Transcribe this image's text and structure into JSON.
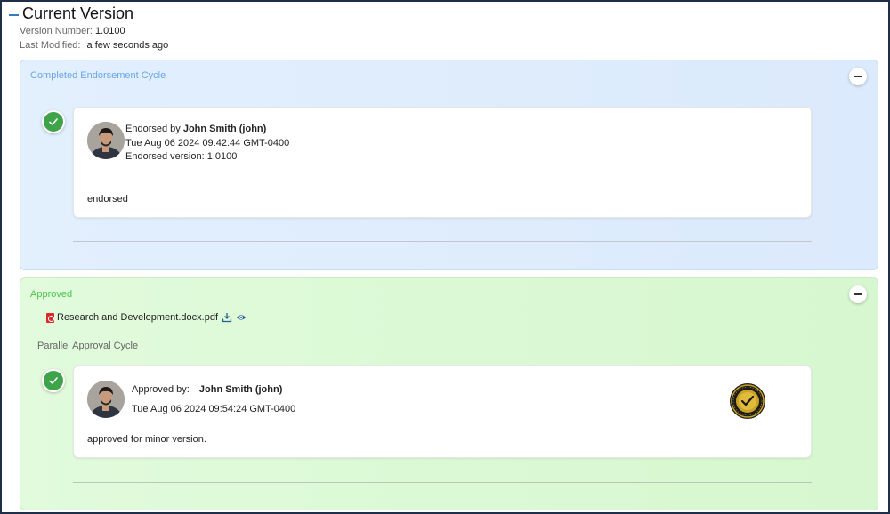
{
  "header": {
    "title": "Current Version",
    "version_label": "Version Number:",
    "version_value": "1.0100",
    "modified_label": "Last Modified:",
    "modified_value": "a few seconds ago"
  },
  "endorsement": {
    "title": "Completed Endorsement Cycle",
    "card": {
      "prefix": "Endorsed by",
      "user": "John Smith (john)",
      "timestamp": "Tue Aug 06 2024 09:42:44 GMT-0400",
      "version_line": "Endorsed version: 1.0100",
      "comment": "endorsed"
    }
  },
  "approved": {
    "title": "Approved",
    "file_name": "Research and Development.docx.pdf",
    "subcycle_title": "Parallel Approval Cycle",
    "card": {
      "label": "Approved by:",
      "user": "John Smith (john)",
      "timestamp": "Tue Aug 06 2024 09:54:24 GMT-0400",
      "comment": "approved for minor version."
    }
  },
  "colors": {
    "endorse_bg": "#dbeafc",
    "approved_bg": "#d6f7cf",
    "check_green": "#3fa34a",
    "endorse_title": "#6aa6e6",
    "approved_title": "#4cc24c"
  },
  "icons": {
    "collapse": "minus-icon",
    "check": "check-icon",
    "file": "pdf-file-icon",
    "download": "download-icon",
    "view": "eye-icon",
    "seal": "approval-seal-icon"
  }
}
